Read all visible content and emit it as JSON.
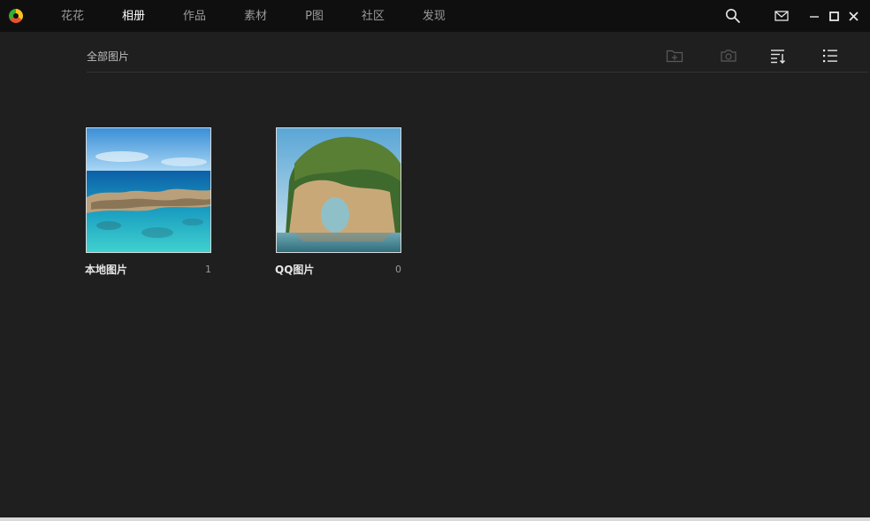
{
  "nav": {
    "items": [
      {
        "label": "花花",
        "active": false
      },
      {
        "label": "相册",
        "active": true
      },
      {
        "label": "作品",
        "active": false
      },
      {
        "label": "素材",
        "active": false
      },
      {
        "label": "P图",
        "active": false
      },
      {
        "label": "社区",
        "active": false
      },
      {
        "label": "发现",
        "active": false
      }
    ]
  },
  "window_controls": [
    "search-icon",
    "mail-icon",
    "minimize-icon",
    "maximize-icon",
    "close-icon"
  ],
  "toolbar": {
    "breadcrumb": "全部图片",
    "buttons": [
      "new-folder-icon",
      "camera-icon",
      "sort-icon",
      "list-view-icon"
    ]
  },
  "albums": [
    {
      "name": "本地图片",
      "count": "1"
    },
    {
      "name": "QQ图片",
      "count": "0"
    }
  ],
  "colors": {
    "background": "#1f1f1f",
    "topbar": "#0f0f0f",
    "active_nav": "#ffffff",
    "inactive_nav": "#9a9a9a"
  }
}
